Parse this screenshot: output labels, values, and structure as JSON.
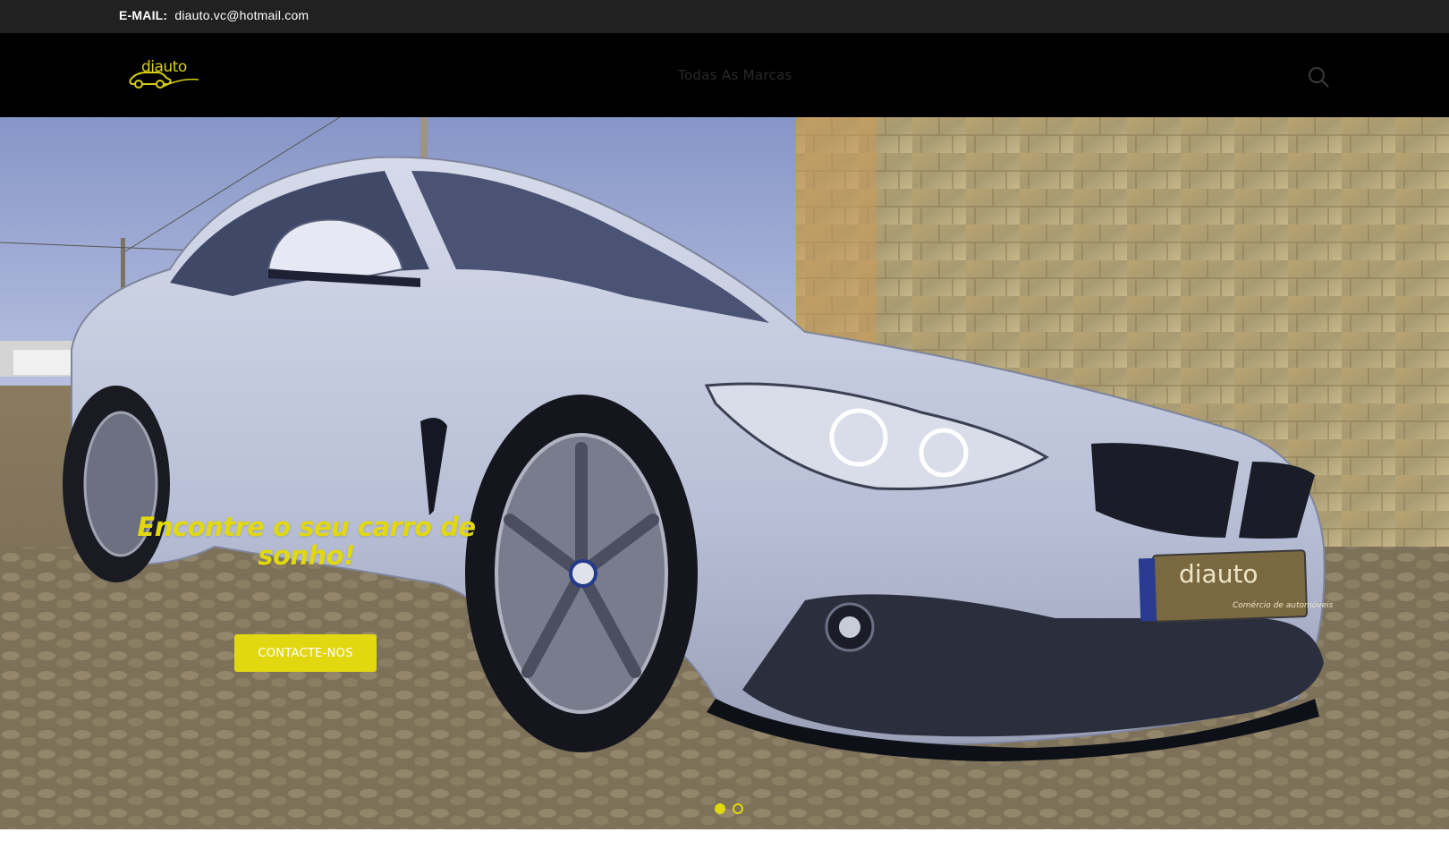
{
  "topbar": {
    "email_label": "E-MAIL:",
    "email_value": "diauto.vc@hotmail.com"
  },
  "header": {
    "logo_text": "diauto",
    "nav_item": "Todas As Marcas",
    "search_icon": "search-icon"
  },
  "hero": {
    "title": "Encontre o seu carro de sonho!",
    "cta_label": "CONTACTE-NOS",
    "plate_brand": "diauto",
    "plate_subtitle": "Comércio de automóveis",
    "slides": [
      "slide-1",
      "slide-2"
    ],
    "active_slide": 1
  },
  "colors": {
    "accent": "#e2d80f",
    "topbar_bg": "#212121",
    "navbar_bg": "#000000"
  }
}
